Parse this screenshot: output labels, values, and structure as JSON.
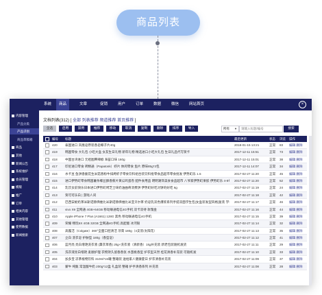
{
  "badge": {
    "label": "商品列表"
  },
  "topnav": {
    "items": [
      "系统",
      "商品",
      "文章",
      "促销",
      "用户",
      "订单",
      "数据",
      "微信",
      "网站首页"
    ],
    "active_index": 1
  },
  "sidebar": {
    "items": [
      {
        "label": "内容管理",
        "level": 1
      },
      {
        "label": "产品分类",
        "level": 2
      },
      {
        "label": "产品识别",
        "level": 2
      },
      {
        "label": "商品草稿箱",
        "level": 2
      },
      {
        "label": "商品",
        "level": 1
      },
      {
        "label": "其他",
        "level": 1
      },
      {
        "label": "新闻公告",
        "level": 1
      },
      {
        "label": "系统维护",
        "level": 1
      },
      {
        "label": "会员管理",
        "level": 1
      },
      {
        "label": "模版",
        "level": 1
      },
      {
        "label": "推广",
        "level": 1
      },
      {
        "label": "订单",
        "level": 1
      },
      {
        "label": "相关内容",
        "level": 1
      },
      {
        "label": "其他管理",
        "level": 1
      },
      {
        "label": "使用数据",
        "level": 1
      },
      {
        "label": "新闻搜索",
        "level": 1
      }
    ],
    "selected_index": 2
  },
  "main": {
    "doc_title_prefix": "文档列表(312) [ ",
    "doc_title_links": [
      "全部",
      "列表推荐",
      "频道推荐",
      "首页推荐"
    ],
    "doc_title_suffix": " ]"
  },
  "toolbar": {
    "buttons": [
      "全选",
      "启用",
      "禁用",
      "推荐",
      "移动",
      "取消",
      "复制",
      "删除",
      "排序",
      "导入"
    ],
    "filter_value": "所有",
    "search_placeholder": "请输入标题/编号",
    "search_button": "搜索"
  },
  "table": {
    "headers": [
      "编号",
      "标题",
      "最后更新",
      "状态",
      "浏览",
      "操作"
    ],
    "rows": [
      {
        "id": "420",
        "title": "泰国进口 凤凰皂原装香皂椰子片40g",
        "time": "2018-01-15 13:21",
        "status": "正常",
        "views": "83",
        "actions": "编辑 删除"
      },
      {
        "id": "419",
        "title": "韩国零食 大礼包 小吃大盒 女友生日礼物 新年礼物 精选进口小吃大礼包 生日礼品代写贺卡",
        "time": "2017-12-11 15:51",
        "status": "正常",
        "views": "73",
        "actions": "编辑 删除"
      },
      {
        "id": "418",
        "title": "中国台湾进口 元祖图腾辣椒 海苔口味 160g",
        "time": "2017-12-11 15:01",
        "status": "正常",
        "views": "38",
        "actions": "编辑 删除"
      },
      {
        "id": "417",
        "title": "印尼进口零食 砖精通（Papatonk）虾片 休闲零食 鱼片 原味85g*2包",
        "time": "2017-12-11 14:07",
        "status": "正常",
        "views": "34",
        "actions": "编辑 删除"
      },
      {
        "id": "416",
        "title": "水卡豆 鱼饼香脆花生米菇香粉牛排烤虾子零食饮料组合装饮料批零食品超市零食批发 伊势町乐 1.5",
        "time": "2017-02-27 11:20",
        "status": "正常",
        "views": "45",
        "actions": "编辑 删除"
      },
      {
        "id": "415",
        "title": "进口伊势町零食韩国薯条椰丝酥香蕉片黄瓜鸡蛋卷 配件食用品 明明潮饰美食食品超市 八爷家伊势町果胶 伊势町乐 4-8号 有熊附",
        "time": "2017-02-27 11:20",
        "status": "正常",
        "views": "52",
        "actions": "编辑 删除"
      },
      {
        "id": "414",
        "title": "乳饮女前快乐日本进口伊势町烤芝士味奶油曲奇消费饼 伊势町好吃对饼的好吃 6g",
        "time": "2017-02-27 11:19",
        "status": "正常",
        "views": "24",
        "actions": "编辑 删除"
      },
      {
        "id": "413",
        "title": "贺可可乐白 | 游戏人间",
        "time": "2017-02-27 11:18",
        "status": "正常",
        "views": "42",
        "actions": "编辑 删除"
      },
      {
        "id": "412",
        "title": "巴西安妮奶茶米斯诺赫佛维比米斯诺赫佛维比米亚贝尔茶 奶皂乳双色爆浆系列手提双面学生包|女盒装发型风格|复装 学年 TF9\\\\W160S XXL",
        "time": "2017-02-27 11:17",
        "status": "正常",
        "views": "46",
        "actions": "编辑 删除"
      },
      {
        "id": "411",
        "title": "vivo X9 全网通 4GB+64GB 移动联通电信4G手机 双卡双待 玫瑰金",
        "time": "2017-02-27 11:16",
        "status": "正常",
        "views": "44",
        "actions": "编辑 删除"
      },
      {
        "id": "410",
        "title": "Apple iPhone 7 Plus (A1661) 128G 黑色 移动联通电信4G手机",
        "time": "2017-02-27 11:15",
        "status": "正常",
        "views": "39",
        "actions": "编辑 删除"
      },
      {
        "id": "409",
        "title": "荣耀 畅玩6X 4GB 32GB 全网通4G手机 高配版 冰河银",
        "time": "2017-02-27 11:14",
        "status": "正常",
        "views": "32",
        "actions": "编辑 删除"
      },
      {
        "id": "408",
        "title": "高露洁（Colgate）360°全面口腔清洁 牙膏 180g（4支装/太阳花）",
        "time": "2017-02-27 11:13",
        "status": "正常",
        "views": "35",
        "actions": "编辑 删除"
      },
      {
        "id": "407",
        "title": "立白 洗衣皂 护肤型 180g（香型皂）",
        "time": "2017-02-27 11:12",
        "status": "正常",
        "views": "41",
        "actions": "编辑 删除"
      },
      {
        "id": "406",
        "title": "蓝月亮 亮白增艳洗衣液 (薰衣草香) 2kg+洗衣液（清新香）1kg补充装 新老包装随机发货",
        "time": "2017-02-27 11:11",
        "status": "正常",
        "views": "29",
        "actions": "编辑 删除"
      },
      {
        "id": "405",
        "title": "洗衣液亮白增艳 柔顺护理 衣物持久留香香氛 水蜜桃香型 护衣型天然 桂花清香补充装 可随机发",
        "time": "2017-02-27 11:10",
        "status": "正常",
        "views": "33",
        "actions": "编辑 删除"
      },
      {
        "id": "404",
        "title": "加多宝 凉茶植物饮料 310ml*24罐 整箱装 送给家人健康夏日 护衣清香补充装",
        "time": "2017-02-27 11:09",
        "status": "正常",
        "views": "37",
        "actions": "编辑 删除"
      },
      {
        "id": "403",
        "title": "蒙牛 纯甄 常温酸牛奶 200g*12盒 礼盒装 整箱 护手清香系列 补充装",
        "time": "2017-02-27 11:08",
        "status": "正常",
        "views": "28",
        "actions": "编辑 删除"
      }
    ]
  }
}
